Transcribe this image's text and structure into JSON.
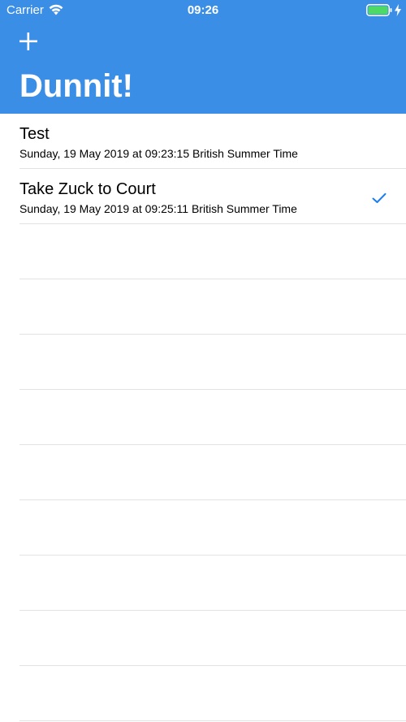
{
  "status_bar": {
    "carrier": "Carrier",
    "time": "09:26",
    "wifi_icon": "wifi-icon",
    "battery_icon": "battery-icon",
    "charging_icon": "charging-bolt-icon",
    "battery_level": 1.0,
    "battery_color": "#4cd964"
  },
  "nav": {
    "title": "Dunnit!",
    "add_icon": "plus-icon",
    "background_color": "#3b8ee6",
    "text_color": "#ffffff"
  },
  "tasks": [
    {
      "title": "Test",
      "subtitle": "Sunday, 19 May 2019 at 09:23:15 British Summer Time",
      "done": false
    },
    {
      "title": "Take Zuck to Court",
      "subtitle": "Sunday, 19 May 2019 at 09:25:11 British Summer Time",
      "done": true,
      "check_icon": "checkmark-icon",
      "check_color": "#1a7cf0"
    }
  ]
}
